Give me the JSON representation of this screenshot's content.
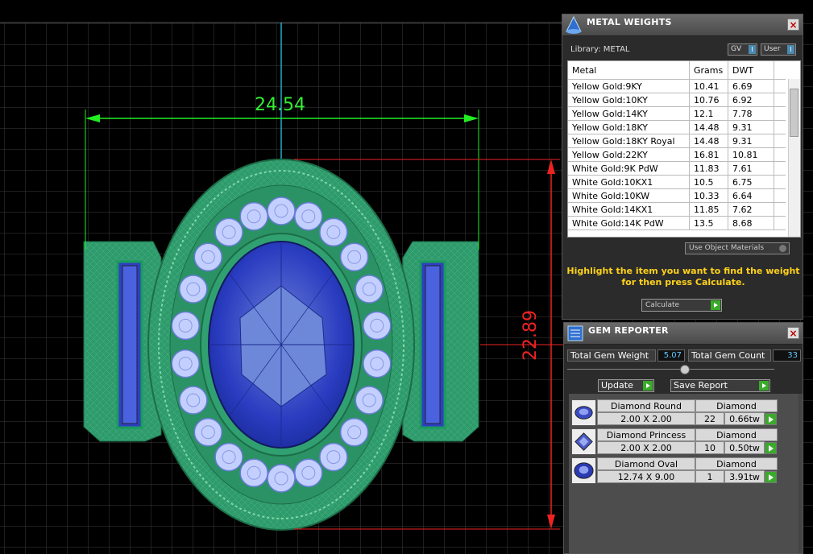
{
  "viewport": {
    "dim_width": "24.54",
    "dim_height": "22.89",
    "colors": {
      "grid": "#3b3b3b",
      "dimension_green": "#22ee22",
      "dimension_red": "#ee2222",
      "metal": "#2e9a6a",
      "stone": "#2233aa",
      "diamond": "#b8c8ff"
    }
  },
  "metal_panel": {
    "title": "METAL WEIGHTS",
    "icon": "cone-icon",
    "library_label": "Library: METAL",
    "gv_label": "GV",
    "user_label": "User",
    "columns": [
      "Metal",
      "Grams",
      "DWT"
    ],
    "rows": [
      [
        "Yellow Gold:9KY",
        "10.41",
        "6.69"
      ],
      [
        "Yellow Gold:10KY",
        "10.76",
        "6.92"
      ],
      [
        "Yellow Gold:14KY",
        "12.1",
        "7.78"
      ],
      [
        "Yellow Gold:18KY",
        "14.48",
        "9.31"
      ],
      [
        "Yellow Gold:18KY Royal",
        "14.48",
        "9.31"
      ],
      [
        "Yellow Gold:22KY",
        "16.81",
        "10.81"
      ],
      [
        "White Gold:9K PdW",
        "11.83",
        "7.61"
      ],
      [
        "White Gold:10KX1",
        "10.5",
        "6.75"
      ],
      [
        "White Gold:10KW",
        "10.33",
        "6.64"
      ],
      [
        "White Gold:14KX1",
        "11.85",
        "7.62"
      ],
      [
        "White Gold:14K PdW",
        "13.5",
        "8.68"
      ]
    ],
    "use_object_materials": "Use Object Materials",
    "instruction": "Highlight the item you want to find the weight for then press Calculate.",
    "calculate_label": "Calculate"
  },
  "gem_panel": {
    "title": "GEM REPORTER",
    "icon": "gem-report-icon",
    "total_weight_label": "Total Gem Weight",
    "total_weight_value": "5.07",
    "total_count_label": "Total Gem Count",
    "total_count_value": "33",
    "update_label": "Update",
    "save_report_label": "Save Report",
    "gems": [
      {
        "name": "Diamond Round",
        "material": "Diamond",
        "size": "2.00 X 2.00",
        "count": "22",
        "weight": "0.66tw",
        "icon": "round-gem-icon"
      },
      {
        "name": "Diamond Princess",
        "material": "Diamond",
        "size": "2.00 X 2.00",
        "count": "10",
        "weight": "0.50tw",
        "icon": "princess-gem-icon"
      },
      {
        "name": "Diamond Oval",
        "material": "Diamond",
        "size": "12.74 X 9.00",
        "count": "1",
        "weight": "3.91tw",
        "icon": "oval-gem-icon"
      }
    ]
  }
}
